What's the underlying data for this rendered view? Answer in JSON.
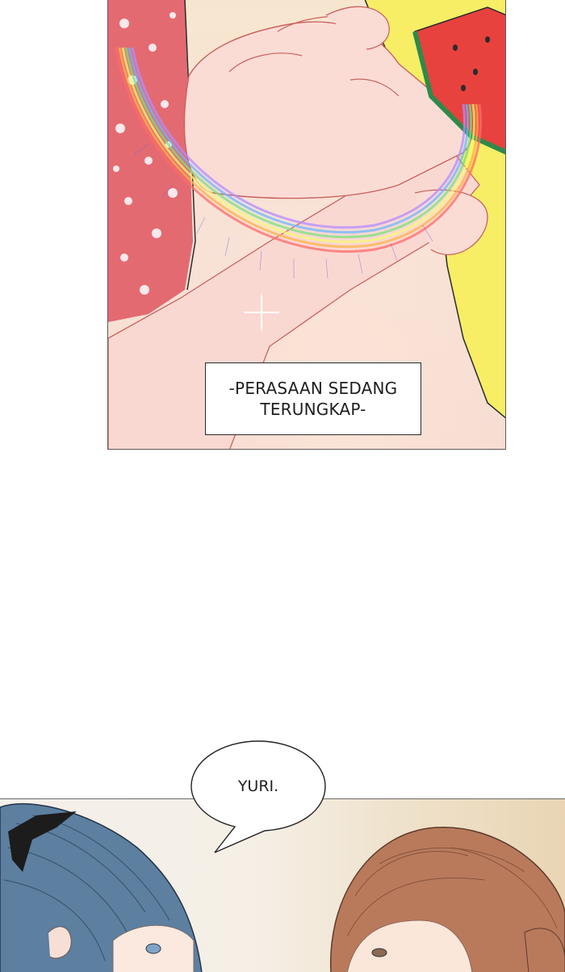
{
  "panel_1": {
    "caption": "-PERASAAN SEDANG TERUNGKAP-"
  },
  "panel_2": {
    "speech_bubble": "YURI."
  }
}
